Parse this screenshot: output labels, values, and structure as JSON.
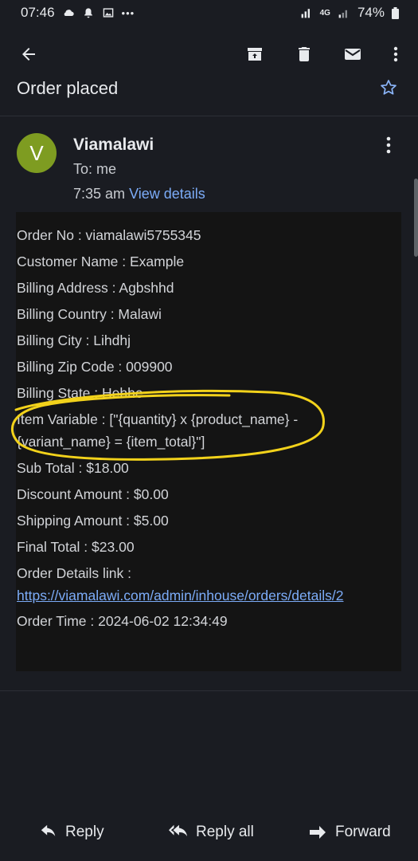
{
  "status_bar": {
    "time": "07:46",
    "dots": "•••",
    "network": "4G",
    "battery": "74%"
  },
  "app_bar": {
    "back_icon": "arrow-back-icon",
    "archive_icon": "archive-icon",
    "delete_icon": "delete-icon",
    "mark_unread_icon": "mail-icon",
    "more_icon": "more-vert-icon"
  },
  "email": {
    "subject": "Order placed",
    "sender": {
      "initial": "V",
      "name": "Viamalawi",
      "to": "To: me",
      "time": "7:35 am",
      "view_details": "View details",
      "avatar_color": "#7e9c21"
    },
    "body_lines": [
      "Order No : viamalawi5755345",
      "Customer Name : Example",
      "Billing Address : Agbshhd",
      "Billing Country : Malawi",
      "Billing City : Lihdhj",
      "Billing Zip Code : 009900",
      "Billing State : Hehhe",
      "Item Variable : [\"{quantity} x {product_name} -",
      "{variant_name} = {item_total}\"]",
      "Sub Total : $18.00",
      "Discount Amount : $0.00",
      "Shipping Amount : $5.00",
      "Final Total : $23.00",
      "Order Details link :"
    ],
    "order_link": "https://viamalawi.com/admin/inhouse/orders/details/2",
    "order_time": "Order Time : 2024-06-02 12:34:49"
  },
  "actions": {
    "reply": "Reply",
    "reply_all": "Reply all",
    "forward": "Forward"
  },
  "colors": {
    "background": "#1a1c22",
    "link": "#7cacf8",
    "highlight_circle": "#f2d21b"
  }
}
